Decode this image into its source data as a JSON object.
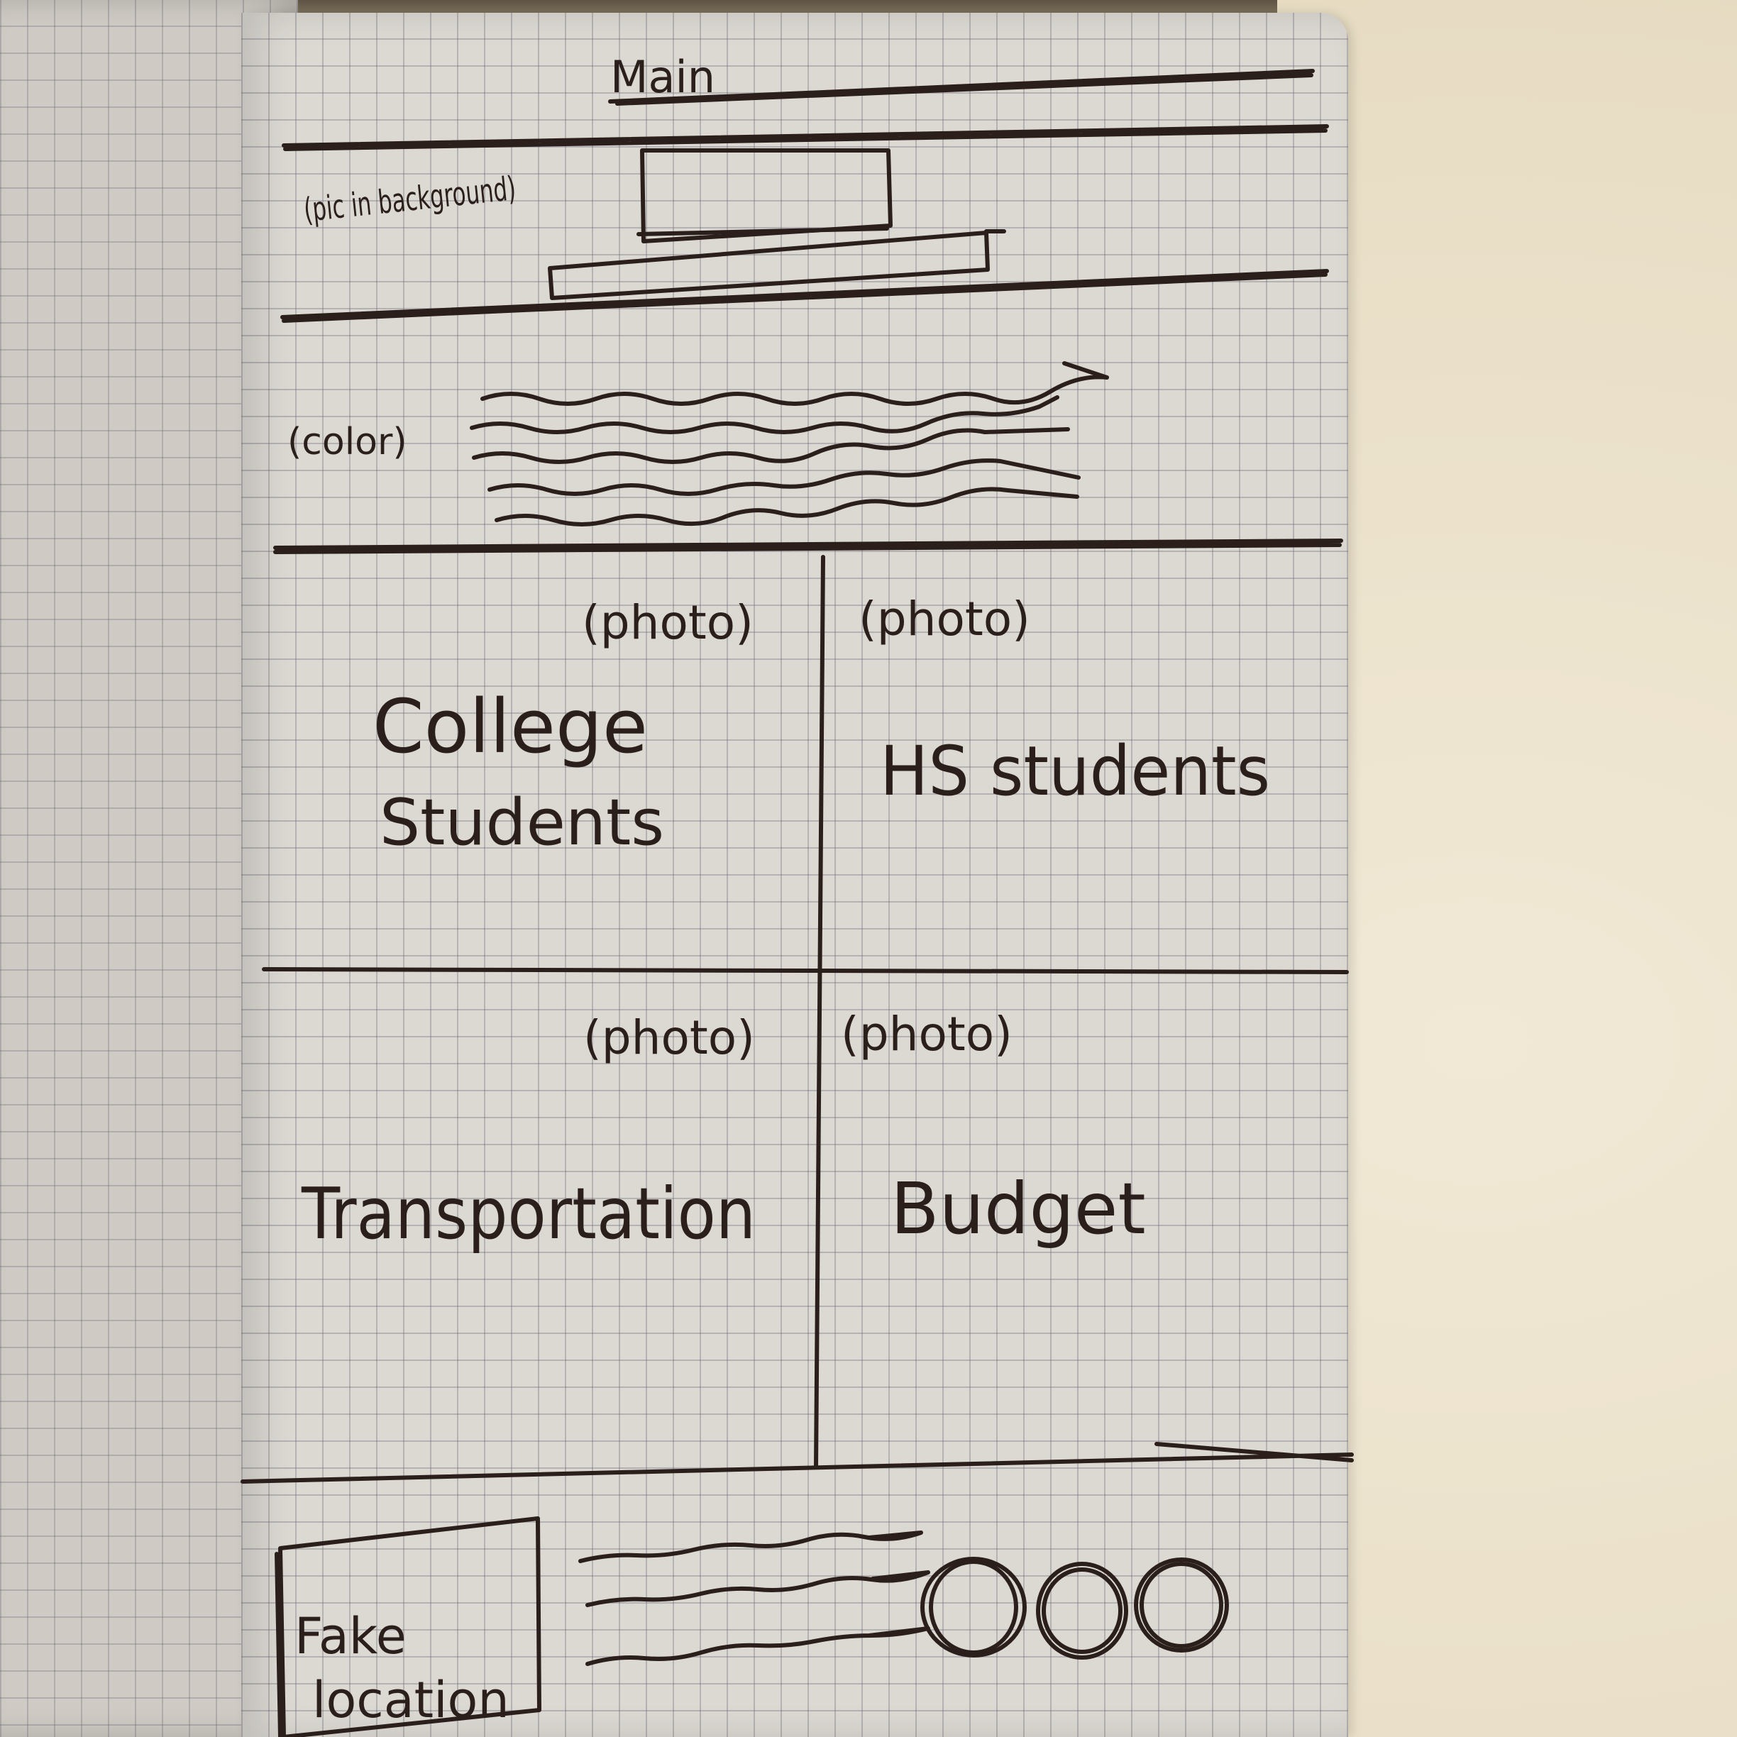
{
  "header": {
    "title": "Main"
  },
  "hero": {
    "note": "(pic in background)"
  },
  "intro": {
    "note": "(color)"
  },
  "tiles": [
    {
      "photo_label": "(photo)",
      "label_line1": "College",
      "label_line2": "Students"
    },
    {
      "photo_label": "(photo)",
      "label": "HS students"
    },
    {
      "photo_label": "(photo)",
      "label": "Transportation"
    },
    {
      "photo_label": "(photo)",
      "label": "Budget"
    }
  ],
  "footer": {
    "map_line1": "Fake",
    "map_line2": "location",
    "social_icons": [
      "circle-icon",
      "circle-icon",
      "circle-icon"
    ]
  },
  "colors": {
    "ink": "#2b1f1c",
    "paper": "#dcd9d3",
    "grid": "#5a5a69",
    "table": "#efe6d2"
  }
}
